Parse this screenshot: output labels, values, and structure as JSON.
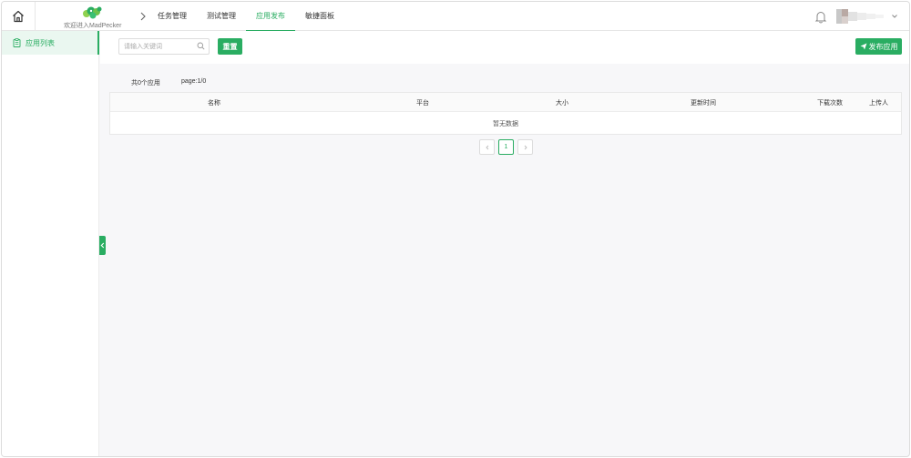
{
  "header": {
    "welcome": "欢迎进入MadPecker",
    "nav": [
      {
        "label": "任务管理",
        "active": false
      },
      {
        "label": "测试管理",
        "active": false
      },
      {
        "label": "应用发布",
        "active": true
      },
      {
        "label": "敏捷面板",
        "active": false
      }
    ],
    "icons": {
      "home": "home-icon",
      "bell": "bell-icon",
      "caret": "chevron-down-icon",
      "logo": "madpecker-logo"
    }
  },
  "sidebar": {
    "items": [
      {
        "label": "应用列表",
        "active": true,
        "icon": "clipboard-icon"
      }
    ]
  },
  "toolbar": {
    "search_placeholder": "请输入关键词",
    "search_value": "",
    "reset_label": "重置",
    "publish_label": "发布应用"
  },
  "info": {
    "total": "共0个应用",
    "page": "page:1/0"
  },
  "table": {
    "columns": [
      "名称",
      "平台",
      "大小",
      "更新时间",
      "下载次数",
      "上传人"
    ],
    "empty_text": "暂无数据"
  },
  "pagination": {
    "current": "1"
  },
  "colors": {
    "accent": "#2aad62",
    "active_bg": "#eaf7f0"
  }
}
